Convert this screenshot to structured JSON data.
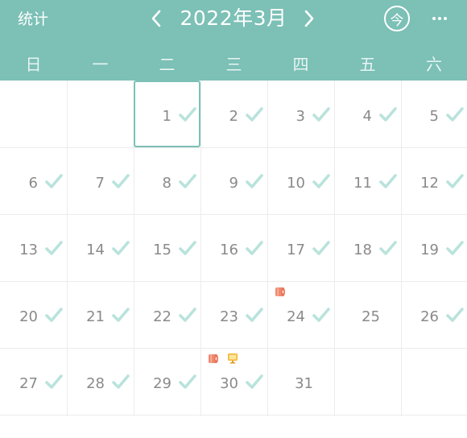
{
  "header": {
    "stats_label": "统计",
    "month_title": "2022年3月",
    "today_label": "今",
    "background": "#7cc0b6"
  },
  "weekdays": [
    "日",
    "一",
    "二",
    "三",
    "四",
    "五",
    "六"
  ],
  "calendar": {
    "selected_day": "1",
    "check_color": "#b9e3dc",
    "days": [
      {
        "label": "1",
        "checked": true
      },
      {
        "label": "2",
        "checked": true
      },
      {
        "label": "3",
        "checked": true
      },
      {
        "label": "4",
        "checked": true
      },
      {
        "label": "5",
        "checked": true
      },
      {
        "label": "6",
        "checked": true
      },
      {
        "label": "7",
        "checked": true
      },
      {
        "label": "8",
        "checked": true
      },
      {
        "label": "9",
        "checked": true
      },
      {
        "label": "10",
        "checked": true
      },
      {
        "label": "11",
        "checked": true
      },
      {
        "label": "12",
        "checked": true
      },
      {
        "label": "13",
        "checked": true
      },
      {
        "label": "14",
        "checked": true
      },
      {
        "label": "15",
        "checked": true
      },
      {
        "label": "16",
        "checked": true
      },
      {
        "label": "17",
        "checked": true
      },
      {
        "label": "18",
        "checked": true
      },
      {
        "label": "19",
        "checked": true
      },
      {
        "label": "20",
        "checked": true
      },
      {
        "label": "21",
        "checked": true
      },
      {
        "label": "22",
        "checked": true
      },
      {
        "label": "23",
        "checked": true
      },
      {
        "label": "24",
        "checked": true,
        "tags": [
          "toilet-roll-icon"
        ]
      },
      {
        "label": "25",
        "checked": false
      },
      {
        "label": "26",
        "checked": true
      },
      {
        "label": "27",
        "checked": true
      },
      {
        "label": "28",
        "checked": true
      },
      {
        "label": "29",
        "checked": true
      },
      {
        "label": "30",
        "checked": true,
        "tags": [
          "toilet-roll-icon",
          "monitor-icon"
        ]
      },
      {
        "label": "31",
        "checked": false
      }
    ]
  }
}
